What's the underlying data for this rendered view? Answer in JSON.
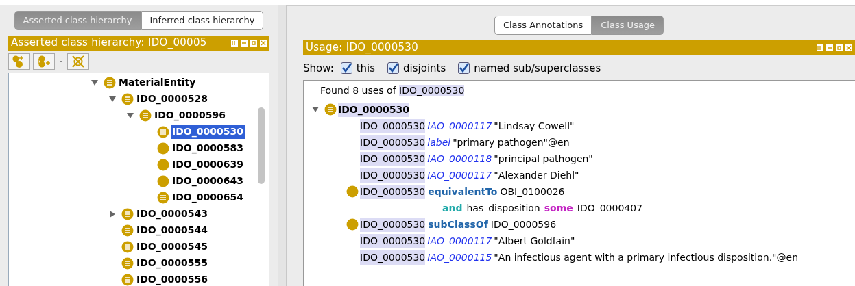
{
  "left_tabs": [
    {
      "label": "Asserted class hierarchy",
      "selected": true
    },
    {
      "label": "Inferred class hierarchy",
      "selected": false
    }
  ],
  "left_header": {
    "title": "Asserted class hierarchy: IDO_00005"
  },
  "tree": [
    {
      "label": "MaterialEntity",
      "kind": "defined",
      "expanded": true,
      "selected": false,
      "children": [
        {
          "label": "IDO_0000528",
          "kind": "defined",
          "expanded": true,
          "selected": false,
          "children": [
            {
              "label": "IDO_0000596",
              "kind": "defined",
              "expanded": true,
              "selected": false,
              "children": [
                {
                  "label": "IDO_0000530",
                  "kind": "defined",
                  "selected": true
                },
                {
                  "label": "IDO_0000583",
                  "kind": "primitive",
                  "selected": false
                },
                {
                  "label": "IDO_0000639",
                  "kind": "primitive",
                  "selected": false
                },
                {
                  "label": "IDO_0000643",
                  "kind": "primitive",
                  "selected": false
                },
                {
                  "label": "IDO_0000654",
                  "kind": "defined",
                  "selected": false
                }
              ]
            }
          ]
        },
        {
          "label": "IDO_0000543",
          "kind": "defined",
          "expanded": false,
          "selected": false
        },
        {
          "label": "IDO_0000544",
          "kind": "defined",
          "selected": false
        },
        {
          "label": "IDO_0000545",
          "kind": "defined",
          "selected": false
        },
        {
          "label": "IDO_0000555",
          "kind": "defined",
          "selected": false
        },
        {
          "label": "IDO_0000556",
          "kind": "defined",
          "selected": false
        }
      ]
    }
  ],
  "right_tabs": [
    {
      "label": "Class Annotations",
      "selected": false
    },
    {
      "label": "Class Usage",
      "selected": true
    }
  ],
  "usage_header": {
    "title": "Usage: IDO_0000530"
  },
  "show": {
    "label": "Show:",
    "options": [
      {
        "label": "this",
        "checked": true
      },
      {
        "label": "disjoints",
        "checked": true
      },
      {
        "label": "named sub/superclasses",
        "checked": true
      }
    ]
  },
  "found": {
    "text": "Found 8 uses of",
    "class": "IDO_0000530"
  },
  "usage_root": {
    "label": "IDO_0000530",
    "expanded": true
  },
  "usage_rows": [
    {
      "kind": "annotation",
      "subject": "IDO_0000530",
      "property": "IAO_0000117",
      "value": "\"Lindsay Cowell\""
    },
    {
      "kind": "annotation",
      "subject": "IDO_0000530",
      "property": "label",
      "value": "\"primary pathogen\"@en"
    },
    {
      "kind": "annotation",
      "subject": "IDO_0000530",
      "property": "IAO_0000118",
      "value": "\"principal pathogen\""
    },
    {
      "kind": "annotation",
      "subject": "IDO_0000530",
      "property": "IAO_0000117",
      "value": "\"Alexander Diehl\""
    },
    {
      "kind": "axiom",
      "subject": "IDO_0000530",
      "keyword": "equivalentTo",
      "value": "OBI_0100026"
    },
    {
      "kind": "expression",
      "parts": [
        {
          "kind": "and",
          "text": "and"
        },
        {
          "kind": "plain",
          "text": "has_disposition"
        },
        {
          "kind": "some",
          "text": "some"
        },
        {
          "kind": "plain",
          "text": "IDO_0000407"
        }
      ]
    },
    {
      "kind": "axiom",
      "subject": "IDO_0000530",
      "keyword": "subClassOf",
      "value": "IDO_0000596"
    },
    {
      "kind": "annotation",
      "subject": "IDO_0000530",
      "property": "IAO_0000117",
      "value": "\"Albert Goldfain\""
    },
    {
      "kind": "annotation",
      "subject": "IDO_0000530",
      "property": "IAO_0000115",
      "value": "\"An infectious agent with a primary infectious disposition.\"@en"
    }
  ]
}
